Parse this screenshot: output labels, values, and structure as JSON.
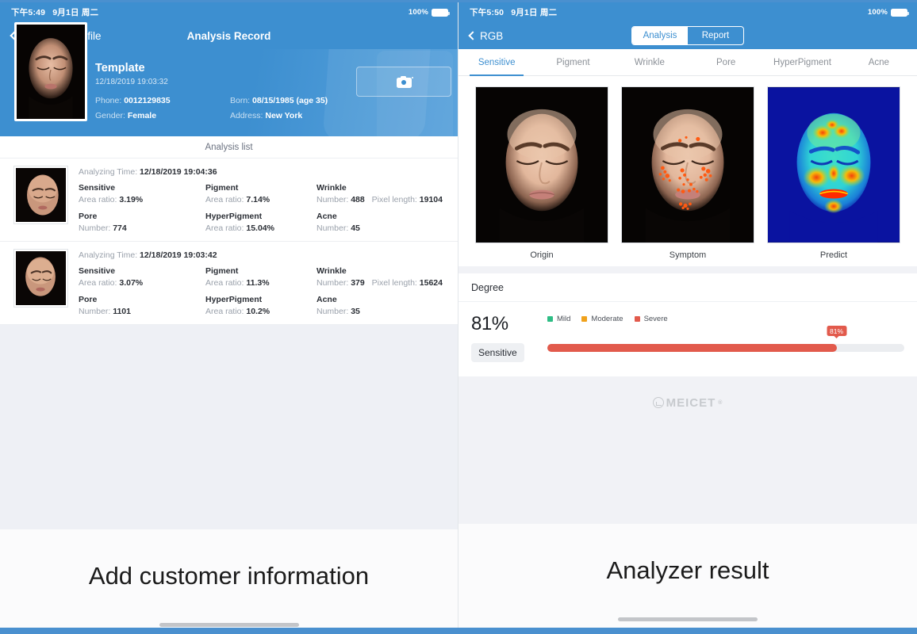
{
  "left": {
    "status": {
      "time": "下午5:49",
      "date": "9月1日 周二",
      "battery": "100%"
    },
    "nav": {
      "back_label": "Customer Profile",
      "title": "Analysis Record",
      "back_icon": "chevron-left-icon"
    },
    "hero": {
      "name": "Template",
      "datetime": "12/18/2019 19:03:32",
      "fields": [
        {
          "label": "Phone:",
          "value": "0012129835"
        },
        {
          "label": "Born:",
          "value": "08/15/1985 (age 35)"
        },
        {
          "label": "Gender:",
          "value": "Female"
        },
        {
          "label": "Address:",
          "value": "New York"
        }
      ],
      "camera_icon": "camera-icon"
    },
    "list_title": "Analysis list",
    "records": [
      {
        "time_label": "Analyzing Time:",
        "time_value": "12/18/2019 19:04:36",
        "metrics": [
          {
            "name": "Sensitive",
            "label": "Area ratio:",
            "value": "3.19%"
          },
          {
            "name": "Pigment",
            "label": "Area ratio:",
            "value": "7.14%"
          },
          {
            "name": "Wrinkle",
            "label": "Number:",
            "value": "488",
            "label2": "Pixel length:",
            "value2": "19104"
          },
          {
            "name": "Pore",
            "label": "Number:",
            "value": "774"
          },
          {
            "name": "HyperPigment",
            "label": "Area ratio:",
            "value": "15.04%"
          },
          {
            "name": "Acne",
            "label": "Number:",
            "value": "45"
          }
        ]
      },
      {
        "time_label": "Analyzing Time:",
        "time_value": "12/18/2019 19:03:42",
        "metrics": [
          {
            "name": "Sensitive",
            "label": "Area ratio:",
            "value": "3.07%"
          },
          {
            "name": "Pigment",
            "label": "Area ratio:",
            "value": "11.3%"
          },
          {
            "name": "Wrinkle",
            "label": "Number:",
            "value": "379",
            "label2": "Pixel length:",
            "value2": "15624"
          },
          {
            "name": "Pore",
            "label": "Number:",
            "value": "1101"
          },
          {
            "name": "HyperPigment",
            "label": "Area ratio:",
            "value": "10.2%"
          },
          {
            "name": "Acne",
            "label": "Number:",
            "value": "35"
          }
        ]
      }
    ],
    "caption": "Add customer information"
  },
  "right": {
    "status": {
      "time": "下午5:50",
      "date": "9月1日 周二",
      "battery": "100%"
    },
    "nav": {
      "back_label": "RGB",
      "back_icon": "chevron-left-icon"
    },
    "segment": {
      "options": [
        "Analysis",
        "Report"
      ],
      "selected": "Analysis"
    },
    "tabs": [
      {
        "label": "Sensitive",
        "active": true
      },
      {
        "label": "Pigment",
        "active": false
      },
      {
        "label": "Wrinkle",
        "active": false
      },
      {
        "label": "Pore",
        "active": false
      },
      {
        "label": "HyperPigment",
        "active": false
      },
      {
        "label": "Acne",
        "active": false
      }
    ],
    "images": [
      {
        "caption": "Origin",
        "kind": "face-plain"
      },
      {
        "caption": "Symptom",
        "kind": "face-marked"
      },
      {
        "caption": "Predict",
        "kind": "face-heatmap"
      }
    ],
    "degree": {
      "section_title": "Degree",
      "percent": "81%",
      "metric_chip": "Sensitive",
      "legend": [
        {
          "label": "Mild",
          "color": "#2ebd85"
        },
        {
          "label": "Moderate",
          "color": "#f0a21c"
        },
        {
          "label": "Severe",
          "color": "#e25a4c"
        }
      ],
      "bar": {
        "value": 81,
        "flag_label": "81%",
        "fill_color": "#e25a4c",
        "track_color": "#ebedf0"
      }
    },
    "watermark": {
      "text": "MEICET",
      "registered": "®",
      "icon": "meicet-logo-icon"
    },
    "caption": "Analyzer result"
  },
  "colors": {
    "brand_blue": "#3d8fd0",
    "frame_blue": "#4a90cf",
    "severe_red": "#e25a4c",
    "page_gray": "#f1f2f6"
  }
}
